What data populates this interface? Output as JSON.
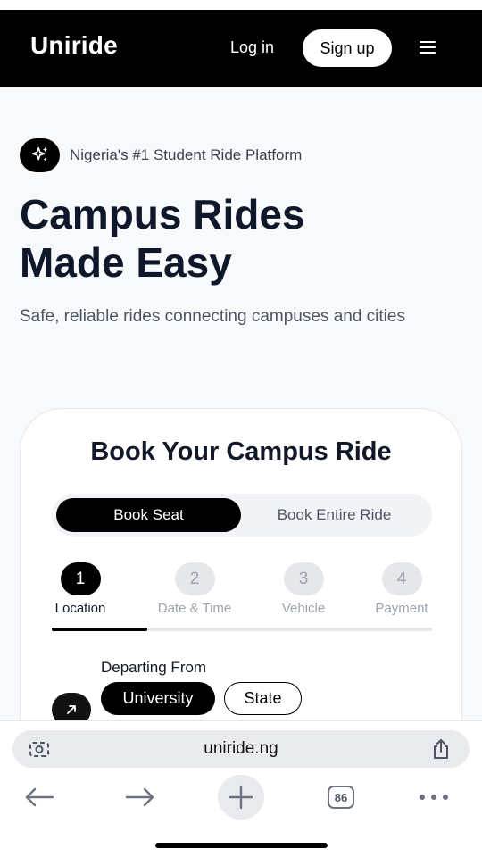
{
  "header": {
    "logo": "Uniride",
    "login_label": "Log in",
    "signup_label": "Sign up"
  },
  "hero": {
    "badge_text": "Nigeria's #1 Student Ride Platform",
    "title_line1": "Campus Rides",
    "title_line2": "Made Easy",
    "subtitle": "Safe, reliable rides connecting campuses and cities"
  },
  "booking": {
    "title": "Book Your Campus Ride",
    "toggle": {
      "options": [
        "Book Seat",
        "Book Entire Ride"
      ],
      "selected": "Book Seat"
    },
    "steps": [
      {
        "number": "1",
        "label": "Location",
        "active": true
      },
      {
        "number": "2",
        "label": "Date & Time",
        "active": false
      },
      {
        "number": "3",
        "label": "Vehicle",
        "active": false
      },
      {
        "number": "4",
        "label": "Payment",
        "active": false
      }
    ],
    "progress_fraction": 0.25,
    "departing_label": "Departing From",
    "departing_options": [
      "University",
      "State"
    ],
    "departing_selected": "University"
  },
  "browser": {
    "url": "uniride.ng",
    "tabs_count": "86",
    "icons": [
      "camera-search-icon",
      "share-icon",
      "back-arrow-icon",
      "forward-arrow-icon",
      "plus-icon",
      "tabs-icon",
      "more-icon"
    ]
  },
  "colors": {
    "brand": "#000000",
    "hero_background": "#f8f9fb",
    "inactive_step": "#e5e7eb"
  }
}
